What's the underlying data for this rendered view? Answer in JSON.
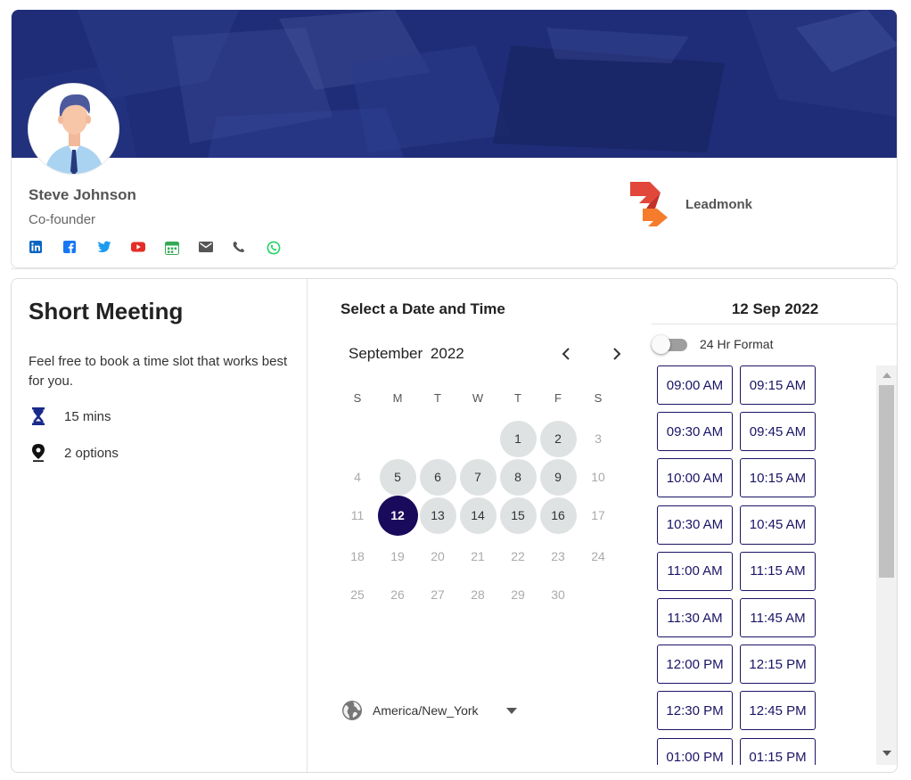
{
  "profile": {
    "name": "Steve Johnson",
    "title": "Co-founder",
    "company": "Leadmonk",
    "social_icons": [
      "linkedin-icon",
      "facebook-icon",
      "twitter-icon",
      "youtube-icon",
      "calendar-icon",
      "email-icon",
      "phone-icon",
      "whatsapp-icon"
    ],
    "banner_color": "#1f2d78"
  },
  "meeting": {
    "title": "Short Meeting",
    "description": "Feel free to book a time slot that works best for you.",
    "duration": "15 mins",
    "location": "2 options"
  },
  "calendar": {
    "heading": "Select a Date and Time",
    "month": "September",
    "year": "2022",
    "weekdays": [
      "S",
      "M",
      "T",
      "W",
      "T",
      "F",
      "S"
    ],
    "weeks": [
      [
        null,
        null,
        null,
        null,
        "1",
        "2",
        "3"
      ],
      [
        "4",
        "5",
        "6",
        "7",
        "8",
        "9",
        "10"
      ],
      [
        "11",
        "12",
        "13",
        "14",
        "15",
        "16",
        "17"
      ],
      [
        "18",
        "19",
        "20",
        "21",
        "22",
        "23",
        "24"
      ],
      [
        "25",
        "26",
        "27",
        "28",
        "29",
        "30",
        null
      ]
    ],
    "available_days": [
      "1",
      "2",
      "5",
      "6",
      "7",
      "8",
      "9",
      "12",
      "13",
      "14",
      "15",
      "16"
    ],
    "selected_day": "12",
    "selected_color": "#1a0a5c",
    "timezone": "America/New_York"
  },
  "slots_panel": {
    "date_label": "12 Sep 2022",
    "format_label": "24 Hr Format",
    "format_24h": false,
    "accent_color": "#1a1466",
    "slots": [
      "09:00 AM",
      "09:15 AM",
      "09:30 AM",
      "09:45 AM",
      "10:00 AM",
      "10:15 AM",
      "10:30 AM",
      "10:45 AM",
      "11:00 AM",
      "11:15 AM",
      "11:30 AM",
      "11:45 AM",
      "12:00 PM",
      "12:15 PM",
      "12:30 PM",
      "12:45 PM",
      "01:00 PM",
      "01:15 PM"
    ]
  }
}
